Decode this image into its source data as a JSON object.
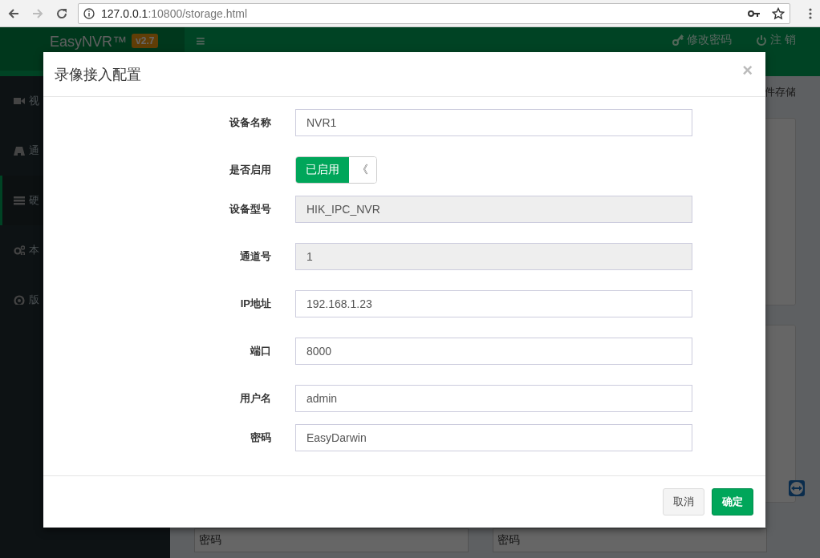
{
  "browser": {
    "url_host": "127.0.0.1",
    "url_path": ":10800/storage.html"
  },
  "navbar": {
    "brand": "EasyNVR™",
    "version": "v2.7",
    "menu_toggle": "≡",
    "links": [
      {
        "kind": "key",
        "label": "修改密码"
      },
      {
        "kind": "power",
        "label": "注 销"
      }
    ]
  },
  "sidebar": {
    "items": [
      {
        "kind": "video",
        "label": "视",
        "selected": false
      },
      {
        "kind": "road",
        "label": "通",
        "selected": false
      },
      {
        "kind": "storage",
        "label": "硬",
        "selected": true
      },
      {
        "kind": "gears",
        "label": "本",
        "selected": false
      },
      {
        "kind": "lifebuoy",
        "label": "版",
        "selected": false
      }
    ]
  },
  "content": {
    "breadcrumb": "件存储",
    "bottom_fields": [
      {
        "label": "密码"
      },
      {
        "label": "密码"
      }
    ]
  },
  "dialog": {
    "title": "录像接入配置",
    "close": "×",
    "fields": [
      {
        "kind": "input",
        "label": "设备名称",
        "value": "NVR1",
        "disabled": false
      },
      {
        "kind": "switch",
        "label": "是否启用",
        "on": true,
        "on_label": "已启用",
        "handle": "《"
      },
      {
        "kind": "input",
        "label": "设备型号",
        "value": "HIK_IPC_NVR",
        "disabled": true
      },
      {
        "kind": "input",
        "label": "通道号",
        "value": "1",
        "disabled": true
      },
      {
        "kind": "input",
        "label": "IP地址",
        "value": "192.168.1.23",
        "disabled": false
      },
      {
        "kind": "input",
        "label": "端口",
        "value": "8000",
        "disabled": false
      },
      {
        "kind": "input",
        "label": "用户名",
        "value": "admin",
        "disabled": false
      },
      {
        "kind": "input",
        "label": "密码",
        "value": "EasyDarwin",
        "disabled": false
      }
    ],
    "buttons": [
      {
        "kind": "default",
        "label": "取消"
      },
      {
        "kind": "primary",
        "label": "确定"
      }
    ]
  }
}
